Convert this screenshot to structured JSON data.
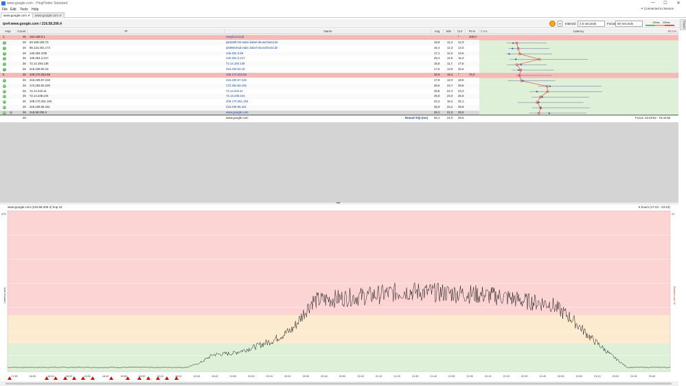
{
  "window": {
    "title": "www.google.com - PingPlotter Standard",
    "connection_status": "Connected to Service",
    "controls": [
      "—",
      "☐",
      "✕"
    ]
  },
  "menu": [
    "File",
    "Edit",
    "Tools",
    "Help"
  ],
  "tabs": [
    {
      "label": "www.google.com",
      "active": true
    },
    {
      "label": "www.google.com",
      "active": false
    }
  ],
  "toolbar": {
    "target": "ipv4:www.google.com / 216.58.206.4",
    "interval_label": "Interval:",
    "interval_value": "2.5 seconds",
    "focus_label": "Focus:",
    "focus_value": "60 seconds",
    "legend_100": "100ms",
    "legend_200": "200ms",
    "side_tab": "Graphs"
  },
  "columns": {
    "hop": "Hop",
    "count": "Count",
    "ip": "IP",
    "name": "Name",
    "avg": "Avg",
    "min": "Min",
    "cur": "Cur",
    "pl": "PL%",
    "latency": "Latency",
    "lat_min": "0 ms",
    "lat_max": "84 ms"
  },
  "rows": [
    {
      "hop": "1",
      "count": "25",
      "ip": "192.168.0.1",
      "name": "easybox.local",
      "avg": "",
      "min": "",
      "cur": "*",
      "pl": "100,0",
      "status": "loss"
    },
    {
      "hop": "2",
      "count": "26",
      "ip": "83.169.183.73",
      "name": "ip53a9b749.static.kabel-deutschland.de",
      "avg": "15,8",
      "min": "11,4",
      "cur": "14,3",
      "pl": "",
      "status": "ok"
    },
    {
      "hop": "3",
      "count": "26",
      "ip": "88.134.201.173",
      "name": "ip5886c9ad.static.kabel-deutschland.de",
      "avg": "16,4",
      "min": "12,3",
      "cur": "14,0",
      "pl": "",
      "status": "ok"
    },
    {
      "hop": "4",
      "count": "26",
      "ip": "145.254.3.88",
      "name": "145.254.3.88",
      "avg": "17,1",
      "min": "11,3",
      "cur": "12,6",
      "pl": "",
      "status": "ok"
    },
    {
      "hop": "5",
      "count": "26",
      "ip": "145.254.2.217",
      "name": "145.254.2.217",
      "avg": "25,4",
      "min": "12,8",
      "cur": "15,4",
      "pl": "",
      "status": "ok"
    },
    {
      "hop": "6",
      "count": "26",
      "ip": "72.14.194.138",
      "name": "72.14.194.138",
      "avg": "15,8",
      "min": "11,7",
      "cur": "17,6",
      "pl": "",
      "status": "ok"
    },
    {
      "hop": "7",
      "count": "26",
      "ip": "216.239.63.19",
      "name": "216.239.63.19",
      "avg": "17,5",
      "min": "13,8",
      "cur": "16,6",
      "pl": "",
      "status": "ok"
    },
    {
      "hop": "8",
      "count": "25",
      "ip": "108.170.253.68",
      "name": "108.170.253.68",
      "avg": "16,9",
      "min": "15,4",
      "cur": "*",
      "pl": "76,0",
      "status": "loss"
    },
    {
      "hop": "9",
      "count": "26",
      "ip": "216.239.57.218",
      "name": "216.239.57.218",
      "avg": "17,8",
      "min": "12,0",
      "cur": "18,5",
      "pl": "",
      "status": "ok"
    },
    {
      "hop": "10",
      "count": "26",
      "ip": "172.253.50.100",
      "name": "172.253.50.100",
      "avg": "28,6",
      "min": "24,7",
      "cur": "29,8",
      "pl": "",
      "status": "ok"
    },
    {
      "hop": "11",
      "count": "26",
      "ip": "72.14.234.11",
      "name": "72.14.234.11",
      "avg": "28,8",
      "min": "21,3",
      "cur": "24,3",
      "pl": "",
      "status": "ok"
    },
    {
      "hop": "12",
      "count": "26",
      "ip": "72.14.239.244",
      "name": "72.14.239.244",
      "avg": "25,8",
      "min": "22,0",
      "cur": "26,6",
      "pl": "",
      "status": "ok"
    },
    {
      "hop": "13",
      "count": "26",
      "ip": "108.170.251.193",
      "name": "108.170.251.193",
      "avg": "24,4",
      "min": "16,2",
      "cur": "25,1",
      "pl": "",
      "status": "ok"
    },
    {
      "hop": "14",
      "count": "26",
      "ip": "216.239.56.151",
      "name": "216.239.56.151",
      "avg": "25,9",
      "min": "22,2",
      "cur": "25,8",
      "pl": "",
      "status": "ok"
    },
    {
      "hop": "15",
      "count": "26",
      "ip": "216.58.206.4",
      "name": "www.google.com",
      "avg": "25,1",
      "min": "21,0",
      "cur": "29,5",
      "pl": "",
      "status": "ok"
    }
  ],
  "round_trip": {
    "count": "26",
    "name": "www.google.com",
    "label": "Round Trip (ms)",
    "avg": "25,1",
    "min": "21,0",
    "cur": "29,5",
    "focus": "Focus: 23:43:52 - 23:44:52"
  },
  "graph": {
    "title": "www.google.com (216.58.206.4) hop 15",
    "range": "6 hours (17:44 - 23:44)",
    "y_label": "Latency (ms)",
    "y2_label": "Packet Loss %",
    "y_top": "570",
    "y2_top": "30",
    "x_ticks": [
      "17:50",
      "18:00",
      "18:10",
      "18:20",
      "18:30",
      "18:40",
      "18:50",
      "19:00",
      "19:10",
      "19:20",
      "19:30",
      "19:40",
      "19:50",
      "20:00",
      "20:10",
      "20:20",
      "20:30",
      "20:40",
      "20:50",
      "21:00",
      "21:10",
      "21:20",
      "21:30",
      "21:40",
      "21:50",
      "22:00",
      "22:10",
      "22:20",
      "22:30",
      "22:40",
      "22:50",
      "23:00",
      "23:10",
      "23:20",
      "23:30",
      "23:40"
    ]
  },
  "colors": {
    "ok": "#5cb85c",
    "loss_row": "#f7b8b8",
    "zone_red": "#fcd4d4",
    "zone_yellow": "#fdebd0",
    "zone_green": "#dff0d8"
  }
}
